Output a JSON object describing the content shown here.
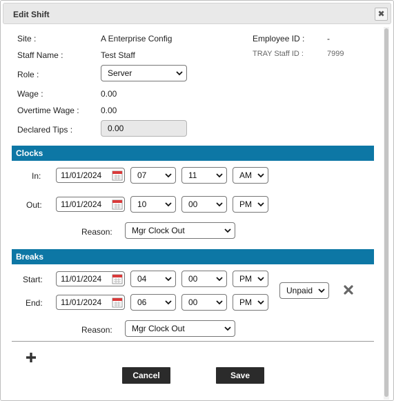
{
  "dialog": {
    "title": "Edit Shift"
  },
  "info": {
    "site_label": "Site :",
    "site_value": "A Enterprise Config",
    "employee_id_label": "Employee ID :",
    "employee_id_value": "-",
    "staff_name_label": "Staff Name :",
    "staff_name_value": "Test Staff",
    "tray_staff_id_label": "TRAY Staff ID :",
    "tray_staff_id_value": "7999",
    "role_label": "Role :",
    "role_value": "Server",
    "wage_label": "Wage :",
    "wage_value": "0.00",
    "overtime_wage_label": "Overtime Wage :",
    "overtime_wage_value": "0.00",
    "declared_tips_label": "Declared Tips :",
    "declared_tips_value": "0.00"
  },
  "clocks": {
    "title": "Clocks",
    "in_label": "In:",
    "in_date": "11/01/2024",
    "in_hour": "07",
    "in_minute": "11",
    "in_ampm": "AM",
    "out_label": "Out:",
    "out_date": "11/01/2024",
    "out_hour": "10",
    "out_minute": "00",
    "out_ampm": "PM",
    "reason_label": "Reason:",
    "reason_value": "Mgr Clock Out"
  },
  "breaks": {
    "title": "Breaks",
    "start_label": "Start:",
    "start_date": "11/01/2024",
    "start_hour": "04",
    "start_minute": "00",
    "start_ampm": "PM",
    "end_label": "End:",
    "end_date": "11/01/2024",
    "end_hour": "06",
    "end_minute": "00",
    "end_ampm": "PM",
    "type_value": "Unpaid",
    "reason_label": "Reason:",
    "reason_value": "Mgr Clock Out"
  },
  "actions": {
    "cancel_label": "Cancel",
    "save_label": "Save"
  },
  "icons": {
    "close": "close-icon",
    "calendar": "calendar-icon",
    "chevron": "chevron-down-icon",
    "delete": "delete-x-icon",
    "add": "plus-icon"
  },
  "colors": {
    "section_header": "#0d77a5",
    "button_bg": "#2b2b2b",
    "calendar_red": "#d93a3a"
  }
}
